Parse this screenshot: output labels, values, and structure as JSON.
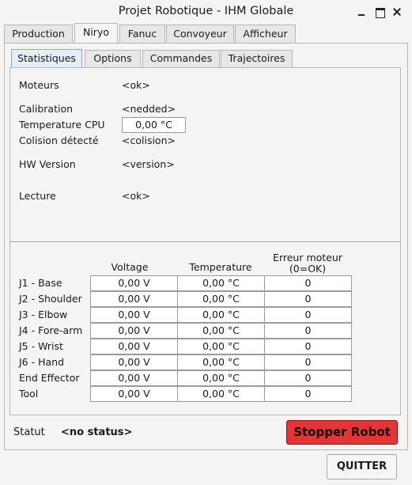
{
  "window": {
    "title": "Projet Robotique - IHM Globale"
  },
  "main_tabs": [
    "Production",
    "Niryo",
    "Fanuc",
    "Convoyeur",
    "Afficheur"
  ],
  "sub_tabs": [
    "Statistiques",
    "Options",
    "Commandes",
    "Trajectoires"
  ],
  "stats": {
    "moteurs_label": "Moteurs",
    "moteurs_value": "<ok>",
    "calibration_label": "Calibration",
    "calibration_value": "<nedded>",
    "temp_cpu_label": "Temperature CPU",
    "temp_cpu_value": "0,00 °C",
    "colision_label": "Colision détecté",
    "colision_value": "<colision>",
    "hw_version_label": "HW Version",
    "hw_version_value": "<version>",
    "lecture_label": "Lecture",
    "lecture_value": "<ok>"
  },
  "joints_table": {
    "headers": {
      "voltage": "Voltage",
      "temperature": "Temperature",
      "erreur_line1": "Erreur moteur",
      "erreur_line2": "(0=OK)"
    },
    "rows": [
      {
        "name": "J1 - Base",
        "voltage": "0,00 V",
        "temperature": "0,00 °C",
        "erreur": "0"
      },
      {
        "name": "J2 - Shoulder",
        "voltage": "0,00 V",
        "temperature": "0,00 °C",
        "erreur": "0"
      },
      {
        "name": "J3 - Elbow",
        "voltage": "0,00 V",
        "temperature": "0,00 °C",
        "erreur": "0"
      },
      {
        "name": "J4 - Fore-arm",
        "voltage": "0,00 V",
        "temperature": "0,00 °C",
        "erreur": "0"
      },
      {
        "name": "J5 - Wrist",
        "voltage": "0,00 V",
        "temperature": "0,00 °C",
        "erreur": "0"
      },
      {
        "name": "J6 - Hand",
        "voltage": "0,00 V",
        "temperature": "0,00 °C",
        "erreur": "0"
      },
      {
        "name": "End Effector",
        "voltage": "0,00 V",
        "temperature": "0,00 °C",
        "erreur": "0"
      },
      {
        "name": "Tool",
        "voltage": "0,00 V",
        "temperature": "0,00 °C",
        "erreur": "0"
      }
    ]
  },
  "status": {
    "label": "Statut",
    "value": "<no status>"
  },
  "buttons": {
    "stop": "Stopper Robot",
    "quit": "QUITTER"
  },
  "colors": {
    "stop_button": "#e23636",
    "active_subtab": "#e4eef8"
  }
}
